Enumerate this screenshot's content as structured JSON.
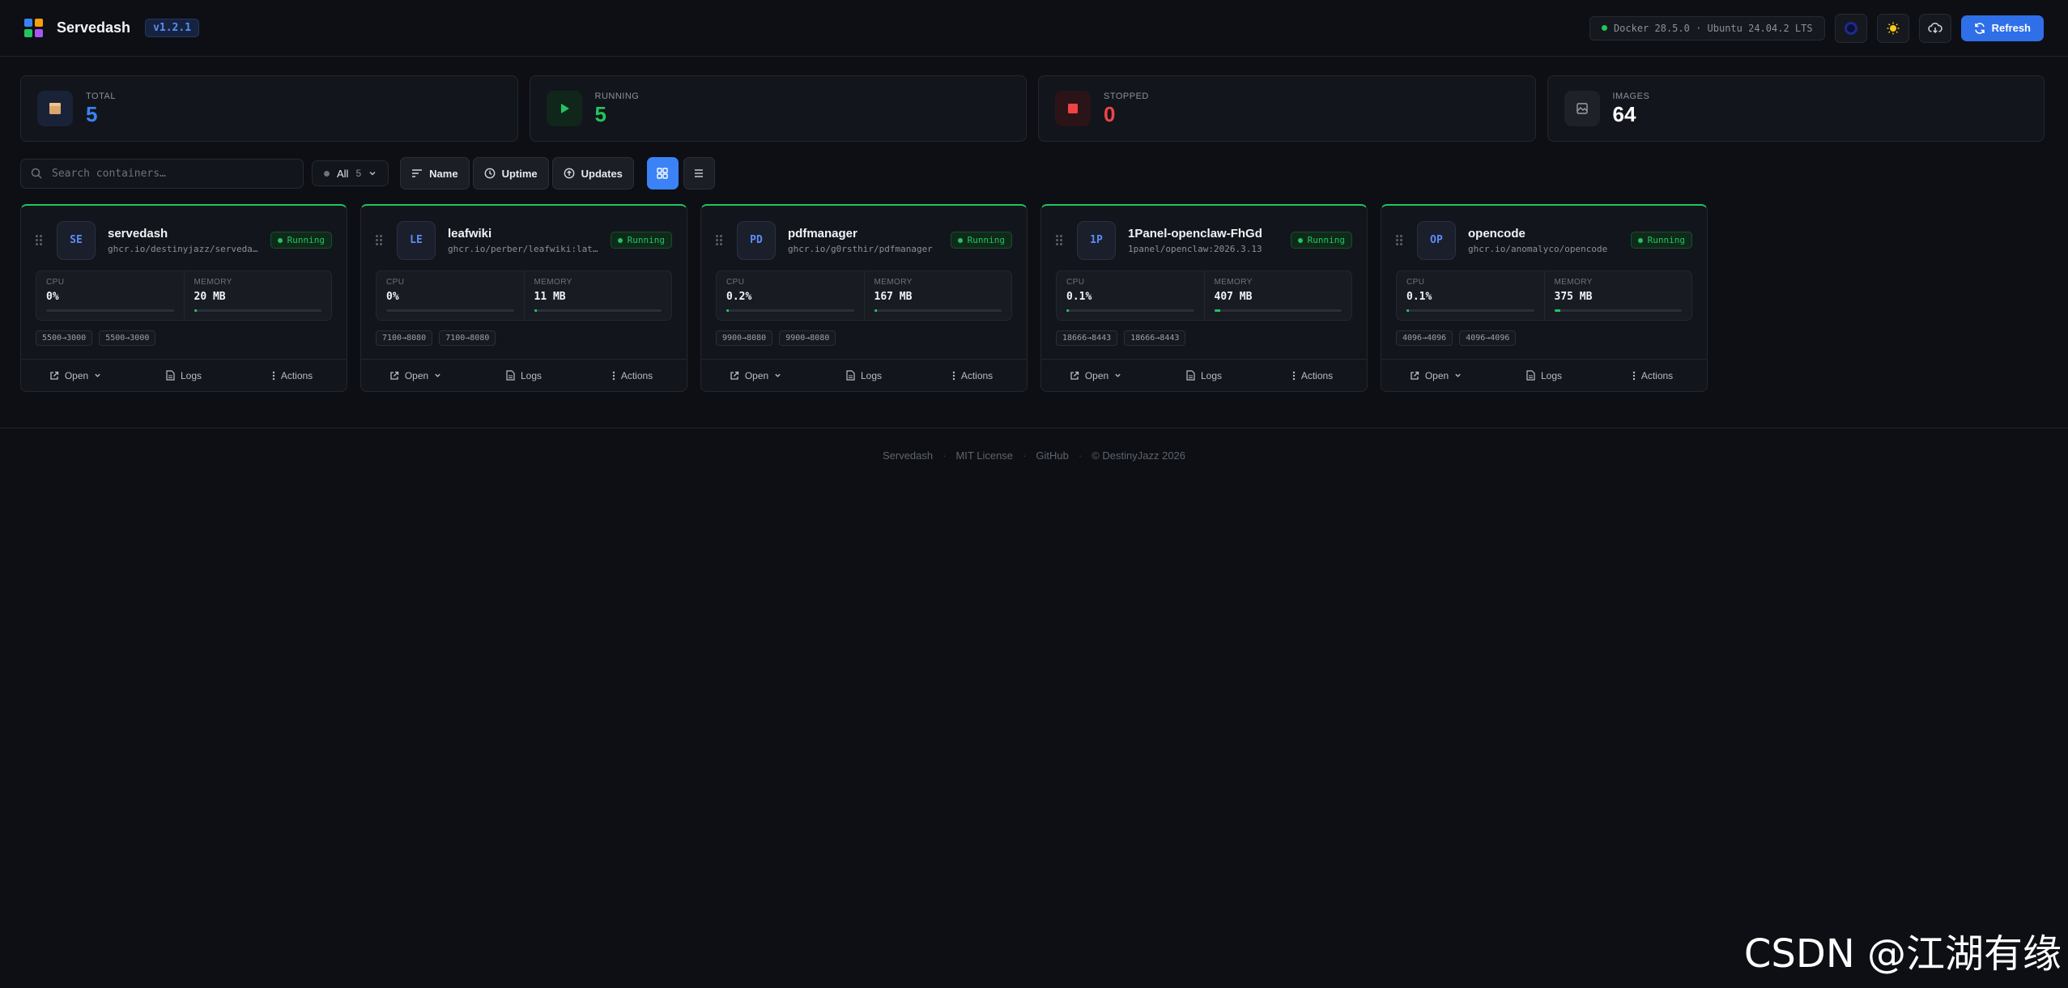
{
  "header": {
    "app_title": "Servedash",
    "version": "v1.2.1",
    "system_info": "Docker 28.5.0 · Ubuntu 24.04.2 LTS",
    "refresh_label": "Refresh"
  },
  "stats": [
    {
      "label": "TOTAL",
      "value": "5",
      "color": "#3b82f6"
    },
    {
      "label": "RUNNING",
      "value": "5",
      "color": "#22c55e"
    },
    {
      "label": "STOPPED",
      "value": "0",
      "color": "#ef4444"
    },
    {
      "label": "IMAGES",
      "value": "64",
      "color": "#ffffff"
    }
  ],
  "toolbar": {
    "search_placeholder": "Search containers…",
    "filter_label": "All",
    "filter_count": "5",
    "sort_name": "Name",
    "sort_uptime": "Uptime",
    "sort_updates": "Updates"
  },
  "containers": [
    {
      "initials": "SE",
      "name": "servedash",
      "image": "ghcr.io/destinyjazz/servedash",
      "status": "Running",
      "cpu_label": "CPU",
      "cpu": "0%",
      "cpu_fraction": 0,
      "mem_label": "MEMORY",
      "mem": "20 MB",
      "mem_fraction": 0.01,
      "ports": [
        "5500→3000",
        "5500→3000"
      ]
    },
    {
      "initials": "LE",
      "name": "leafwiki",
      "image": "ghcr.io/perber/leafwiki:latest",
      "status": "Running",
      "cpu_label": "CPU",
      "cpu": "0%",
      "cpu_fraction": 0,
      "mem_label": "MEMORY",
      "mem": "11 MB",
      "mem_fraction": 0.005,
      "ports": [
        "7100→8080",
        "7100→8080"
      ]
    },
    {
      "initials": "PD",
      "name": "pdfmanager",
      "image": "ghcr.io/g0rsthir/pdfmanager",
      "status": "Running",
      "cpu_label": "CPU",
      "cpu": "0.2%",
      "cpu_fraction": 0.002,
      "mem_label": "MEMORY",
      "mem": "167 MB",
      "mem_fraction": 0.02,
      "ports": [
        "9900→8080",
        "9900→8080"
      ]
    },
    {
      "initials": "1P",
      "name": "1Panel-openclaw-FhGd",
      "image": "1panel/openclaw:2026.3.13",
      "status": "Running",
      "cpu_label": "CPU",
      "cpu": "0.1%",
      "cpu_fraction": 0.001,
      "mem_label": "MEMORY",
      "mem": "407 MB",
      "mem_fraction": 0.05,
      "ports": [
        "18666→8443",
        "18666→8443"
      ]
    },
    {
      "initials": "OP",
      "name": "opencode",
      "image": "ghcr.io/anomalyco/opencode",
      "status": "Running",
      "cpu_label": "CPU",
      "cpu": "0.1%",
      "cpu_fraction": 0.001,
      "mem_label": "MEMORY",
      "mem": "375 MB",
      "mem_fraction": 0.045,
      "ports": [
        "4096→4096",
        "4096→4096"
      ]
    }
  ],
  "card_actions": {
    "open": "Open",
    "logs": "Logs",
    "actions": "Actions"
  },
  "footer": {
    "brand": "Servedash",
    "license": "MIT License",
    "github": "GitHub",
    "copyright": "© DestinyJazz 2026"
  },
  "watermark": "CSDN @江湖有缘"
}
